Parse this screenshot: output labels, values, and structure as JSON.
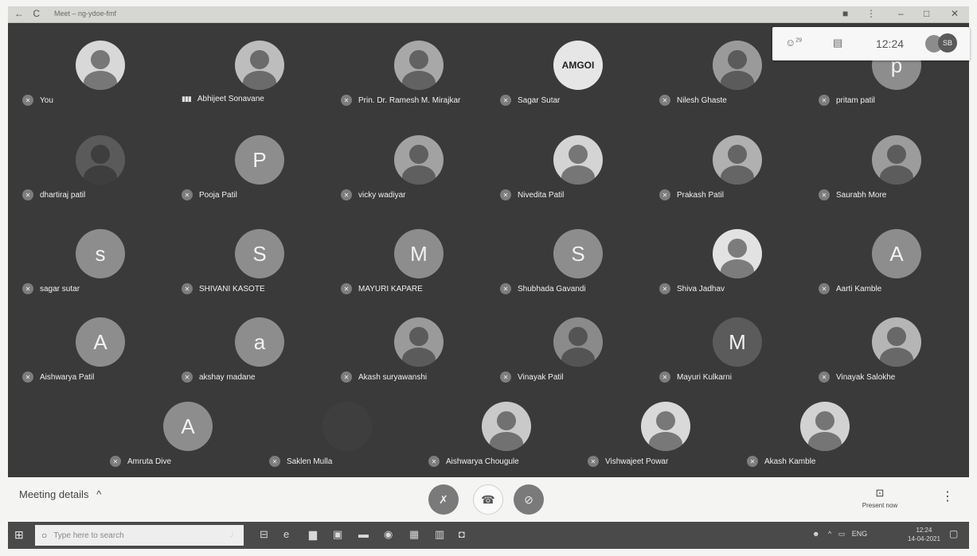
{
  "browser": {
    "title": "Meet – ng-ydoe-fmf",
    "back_icon": "←",
    "reload_icon": "C"
  },
  "top_panel": {
    "people_icon": "people-icon",
    "people_count": "29",
    "chat_icon": "chat-icon",
    "time": "12:24",
    "account_initials": "SB"
  },
  "participants": [
    {
      "name": "You",
      "avatar": "photo",
      "color": "#d8d8d8"
    },
    {
      "name": "Abhijeet Sonavane",
      "avatar": "photo",
      "color": "#bdbdbd",
      "speaking": true
    },
    {
      "name": "Prin. Dr. Ramesh M. Mirajkar",
      "avatar": "photo",
      "color": "#a8a8a8"
    },
    {
      "name": "Sagar Sutar",
      "avatar": "logo",
      "logo_text": "AMGOI",
      "color": "#e6e6e6"
    },
    {
      "name": "Nilesh Ghaste",
      "avatar": "photo",
      "color": "#9a9a9a"
    },
    {
      "name": "pritam patil",
      "avatar": "letter",
      "letter": "p",
      "color": "#8d8d8d"
    },
    {
      "name": "dhartiraj patil",
      "avatar": "photo",
      "color": "#5a5a5a"
    },
    {
      "name": "Pooja Patil",
      "avatar": "letter",
      "letter": "P",
      "color": "#8d8d8d"
    },
    {
      "name": "vicky wadiyar",
      "avatar": "photo",
      "color": "#a2a2a2"
    },
    {
      "name": "Nivedita Patil",
      "avatar": "photo",
      "color": "#d4d4d4"
    },
    {
      "name": "Prakash Patil",
      "avatar": "photo",
      "color": "#b0b0b0"
    },
    {
      "name": "Saurabh More",
      "avatar": "photo",
      "color": "#9c9c9c"
    },
    {
      "name": "sagar sutar",
      "avatar": "letter",
      "letter": "s",
      "color": "#8d8d8d"
    },
    {
      "name": "SHIVANI KASOTE",
      "avatar": "letter",
      "letter": "S",
      "color": "#8d8d8d"
    },
    {
      "name": "MAYURI KAPARE",
      "avatar": "letter",
      "letter": "M",
      "color": "#8d8d8d"
    },
    {
      "name": "Shubhada Gavandi",
      "avatar": "letter",
      "letter": "S",
      "color": "#8d8d8d"
    },
    {
      "name": "Shiva Jadhav",
      "avatar": "photo",
      "color": "#e2e2e2"
    },
    {
      "name": "Aarti Kamble",
      "avatar": "letter",
      "letter": "A",
      "color": "#8d8d8d"
    },
    {
      "name": "Aishwarya Patil",
      "avatar": "letter",
      "letter": "A",
      "color": "#8d8d8d"
    },
    {
      "name": "akshay madane",
      "avatar": "letter",
      "letter": "a",
      "color": "#8d8d8d"
    },
    {
      "name": "Akash suryawanshi",
      "avatar": "photo",
      "color": "#9a9a9a"
    },
    {
      "name": "Vinayak Patil",
      "avatar": "photo",
      "color": "#8a8a8a"
    },
    {
      "name": "Mayuri Kulkarni",
      "avatar": "letter",
      "letter": "M",
      "color": "#5b5b5b"
    },
    {
      "name": "Vinayak Salokhe",
      "avatar": "photo",
      "color": "#b5b5b5"
    },
    {
      "name": "Amruta Dive",
      "avatar": "letter",
      "letter": "A",
      "color": "#8d8d8d"
    },
    {
      "name": "Saklen Mulla",
      "avatar": "blank",
      "color": "#3e3e3e"
    },
    {
      "name": "Aishwarya Chougule",
      "avatar": "photo",
      "color": "#c9c9c9"
    },
    {
      "name": "Vishwajeet Powar",
      "avatar": "photo",
      "color": "#d9d9d9"
    },
    {
      "name": "Akash Kamble",
      "avatar": "photo",
      "color": "#d2d2d2"
    }
  ],
  "controls": {
    "meeting_details": "Meeting details",
    "present_label": "Present now"
  },
  "taskbar": {
    "search_placeholder": "Type here to search",
    "lang": "ENG",
    "time": "12:24",
    "date": "14-04-2021"
  }
}
